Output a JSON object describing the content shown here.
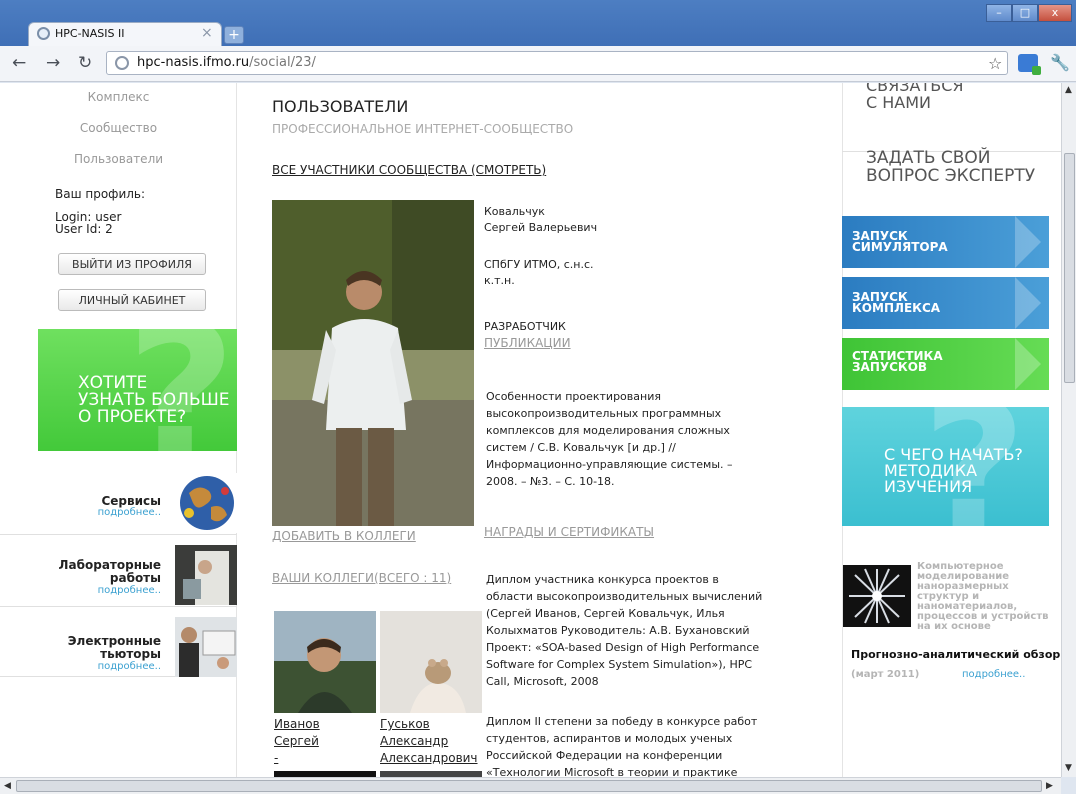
{
  "browser": {
    "tab_title": "HPC-NASIS II",
    "url_host": "hpc-nasis.ifmo.ru",
    "url_path": "/social/23/"
  },
  "left_nav": {
    "items": [
      "Комплекс",
      "Сообщество",
      "Пользователи"
    ],
    "profile_heading": "Ваш профиль:",
    "login": "Login: user",
    "user_id": "User Id: 2",
    "logout_button": "ВЫЙТИ ИЗ ПРОФИЛЯ",
    "cabinet_button": "ЛИЧНЫЙ КАБИНЕТ",
    "promo": {
      "line1": "ХОТИТЕ",
      "line2": "УЗНАТЬ БОЛЬШЕ",
      "line3": "О ПРОЕКТЕ?"
    },
    "services": [
      {
        "title_line1": "Сервисы",
        "title_line2": "",
        "more": "подробнее.."
      },
      {
        "title_line1": "Лабораторные",
        "title_line2": "работы",
        "more": "подробнее.."
      },
      {
        "title_line1": "Электронные",
        "title_line2": "тьюторы",
        "more": "подробнее.."
      }
    ]
  },
  "main": {
    "title": "ПОЛЬЗОВАТЕЛИ",
    "subtitle": "ПРОФЕССИОНАЛЬНОЕ ИНТЕРНЕТ-СООБЩЕСТВО",
    "all_members_link": "ВСЕ УЧАСТНИКИ СООБЩЕСТВА (СМОТРЕТЬ)",
    "user": {
      "surname": "Ковальчук",
      "name": "Сергей Валерьевич",
      "affiliation_line1": "СПбГУ ИТМО, с.н.с.",
      "affiliation_line2": "к.т.н.",
      "role": "РАЗРАБОТЧИК"
    },
    "publications_link": "ПУБЛИКАЦИИ",
    "publication_lines": [
      "Особенности проектирования",
      "высокопроизводительных программных",
      "комплексов для моделирования сложных",
      "систем / С.В. Ковальчук [и др.] //",
      "Информационно-управляющие системы. –",
      "2008. – №3. – С. 10-18."
    ],
    "add_colleague_link": "ДОБАВИТЬ В КОЛЛЕГИ",
    "awards_link": "НАГРАДЫ И СЕРТИФИКАТЫ",
    "award1_lines": [
      "Диплом участника конкурса проектов в",
      "области высокопроизводительных вычислений",
      "(Сергей Иванов, Сергей Ковальчук, Илья",
      "Колыхматов Руководитель: А.В. Бухановский",
      "Проект: «SOA-based Design of High Performance",
      "Software for Complex System Simulation»), HPC",
      "Call, Microsoft,   2008"
    ],
    "award2_lines": [
      "Диплом II степени за победу в конкурсе работ",
      "студентов, аспирантов и молодых ученых",
      "Российской Федерации на конференции",
      "«Технологии Microsoft в теории и практике"
    ],
    "colleagues_link": "ВАШИ КОЛЛЕГИ(ВСЕГО : 11)",
    "colleagues": [
      {
        "line1": "Иванов",
        "line2": "Сергей",
        "line3": "-"
      },
      {
        "line1": "Гуськов",
        "line2": "Александр",
        "line3": "Александрович"
      }
    ]
  },
  "right": {
    "contact_line1": "СВЯЗАТЬСЯ",
    "contact_line2": "С НАМИ",
    "ask_line1": "ЗАДАТЬ СВОЙ",
    "ask_line2": "ВОПРОС ЭКСПЕРТУ",
    "buttons": [
      {
        "line1": "ЗАПУСК",
        "line2": "СИМУЛЯТОРА",
        "color": "#2a7fc0"
      },
      {
        "line1": "ЗАПУСК",
        "line2": "КОМПЛЕКСА",
        "color": "#2a7fc0"
      },
      {
        "line1": "СТАТИСТИКА",
        "line2": "ЗАПУСКОВ",
        "color": "#45c93b"
      }
    ],
    "start_line1": "С ЧЕГО НАЧАТЬ?",
    "start_line2": "МЕТОДИКА",
    "start_line3": "ИЗУЧЕНИЯ",
    "nano_lines": [
      "Компьютерное",
      "моделирование",
      "наноразмерных",
      "структур и",
      "наноматериалов,",
      "процессов и устройств",
      "на их основе"
    ],
    "nano_title": "Прогнозно-аналитический обзор",
    "nano_date": "(март 2011)",
    "nano_more": "подробнее.."
  }
}
